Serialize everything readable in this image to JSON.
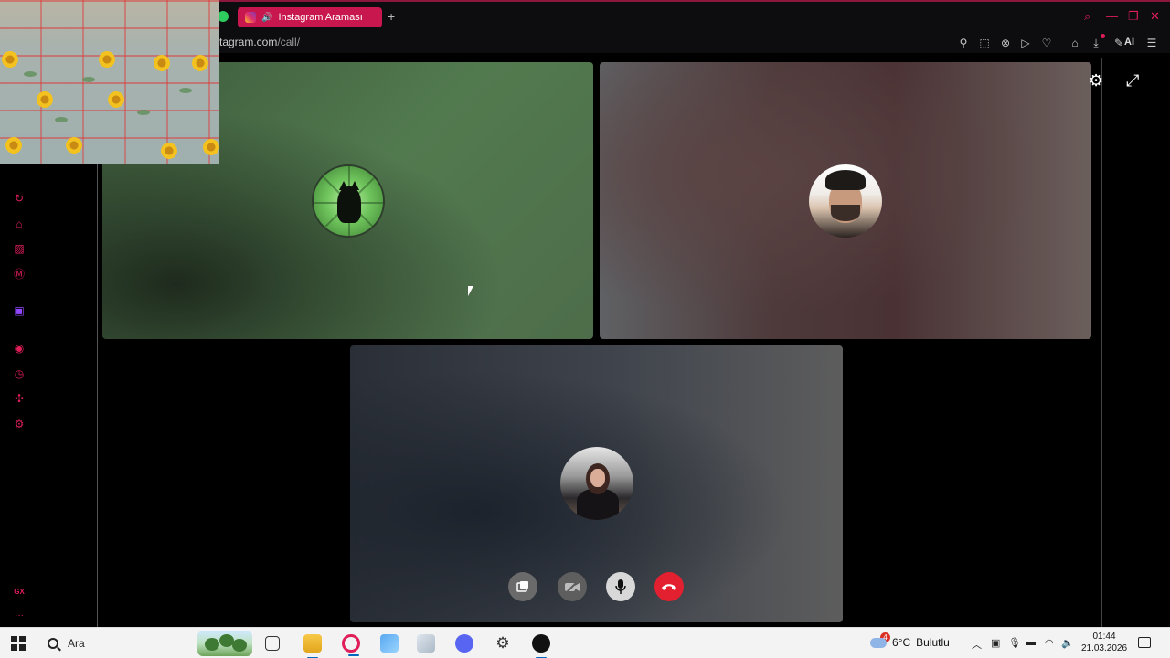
{
  "browser": {
    "tab_title": "Instagram Araması",
    "new_tab_label": "+",
    "url_host": "tagram.com",
    "url_path": "/call/",
    "ai_label": "AI"
  },
  "window_controls": {
    "search": "⌕",
    "minimize": "—",
    "restore": "❐",
    "close": "✕"
  },
  "toolbar_icons": [
    "pin-icon",
    "snapshot-icon",
    "shield-icon",
    "play-icon",
    "heart-icon",
    "account-icon",
    "download-icon",
    "aria-icon",
    "menu-icon"
  ],
  "sidebar_icons": [
    "speed-dial-icon",
    "home-icon",
    "tasks-icon",
    "messenger-icon",
    "twitch-icon",
    "player-icon",
    "history-icon",
    "extensions-icon",
    "settings-icon",
    "gx-icon",
    "more-icon"
  ],
  "sidebar_bottom": {
    "gx": "GX",
    "more": "···"
  },
  "call": {
    "participants": [
      {
        "avatar": "black-cat-avatar"
      },
      {
        "avatar": "man-avatar"
      },
      {
        "avatar": "woman-avatar"
      }
    ],
    "controls": [
      "share-screen",
      "camera-off",
      "microphone",
      "end-call"
    ]
  },
  "colors": {
    "accent": "#e01e5a",
    "end_call": "#e2202f"
  },
  "taskbar": {
    "search_label": "Ara",
    "weather_temp": "6°C",
    "weather_desc": "Bulutlu",
    "weather_badge": "4",
    "time": "01:44",
    "date": "21.03.2026"
  }
}
